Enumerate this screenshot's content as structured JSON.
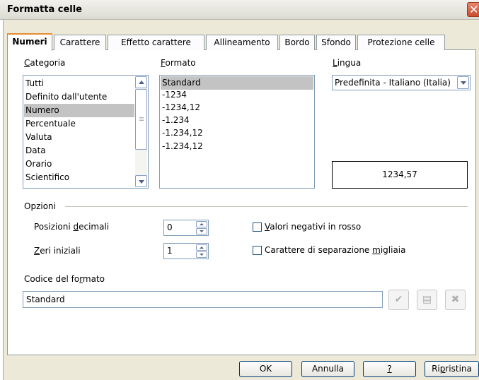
{
  "window": {
    "title": "Formatta celle",
    "close_glyph": "✕"
  },
  "tabs": [
    {
      "label": "Numeri",
      "active": true
    },
    {
      "label": "Carattere"
    },
    {
      "label": "Effetto carattere"
    },
    {
      "label": "Allineamento"
    },
    {
      "label": "Bordo"
    },
    {
      "label": "Sfondo"
    },
    {
      "label": "Protezione celle"
    }
  ],
  "categoria": {
    "label_u": "C",
    "label_rest": "ategoria",
    "items": [
      "Tutti",
      "Definito dall'utente",
      "Numero",
      "Percentuale",
      "Valuta",
      "Data",
      "Orario",
      "Scientifico"
    ],
    "selected": "Numero"
  },
  "formato": {
    "label_u": "F",
    "label_rest": "ormato",
    "items": [
      "Standard",
      "-1234",
      "-1234,12",
      "-1.234",
      "-1.234,12",
      "-1.234,12"
    ],
    "selected": "Standard"
  },
  "lingua": {
    "label_u": "L",
    "label_rest": "ingua",
    "value": "Predefinita - Italiano (Italia)"
  },
  "preview": {
    "value": "1234,57"
  },
  "opzioni": {
    "label": "Opzioni",
    "decimali": {
      "label_pre": "Posizioni ",
      "label_u": "d",
      "label_post": "ecimali",
      "value": "0"
    },
    "zeri": {
      "label_u": "Z",
      "label_post": "eri iniziali",
      "value": "1"
    },
    "negativi": {
      "label_u": "V",
      "label_post": "alori negativi in rosso",
      "checked": false
    },
    "migliaia": {
      "label_pre": "Carattere di separazione ",
      "label_u": "m",
      "label_post": "igliaia",
      "checked": false
    }
  },
  "codice": {
    "label_pre": "Codice del fo",
    "label_u": "r",
    "label_post": "mato",
    "value": "Standard",
    "actions": [
      {
        "icon": "check-icon",
        "glyph": "✔"
      },
      {
        "icon": "edit-comment-icon",
        "glyph": "▤"
      },
      {
        "icon": "delete-icon",
        "glyph": "✖"
      }
    ]
  },
  "buttons": {
    "ok": "OK",
    "annulla": "Annulla",
    "help": "?",
    "ripristina_pre": "Ri",
    "ripristina_u": "p",
    "ripristina_post": "ristina"
  }
}
